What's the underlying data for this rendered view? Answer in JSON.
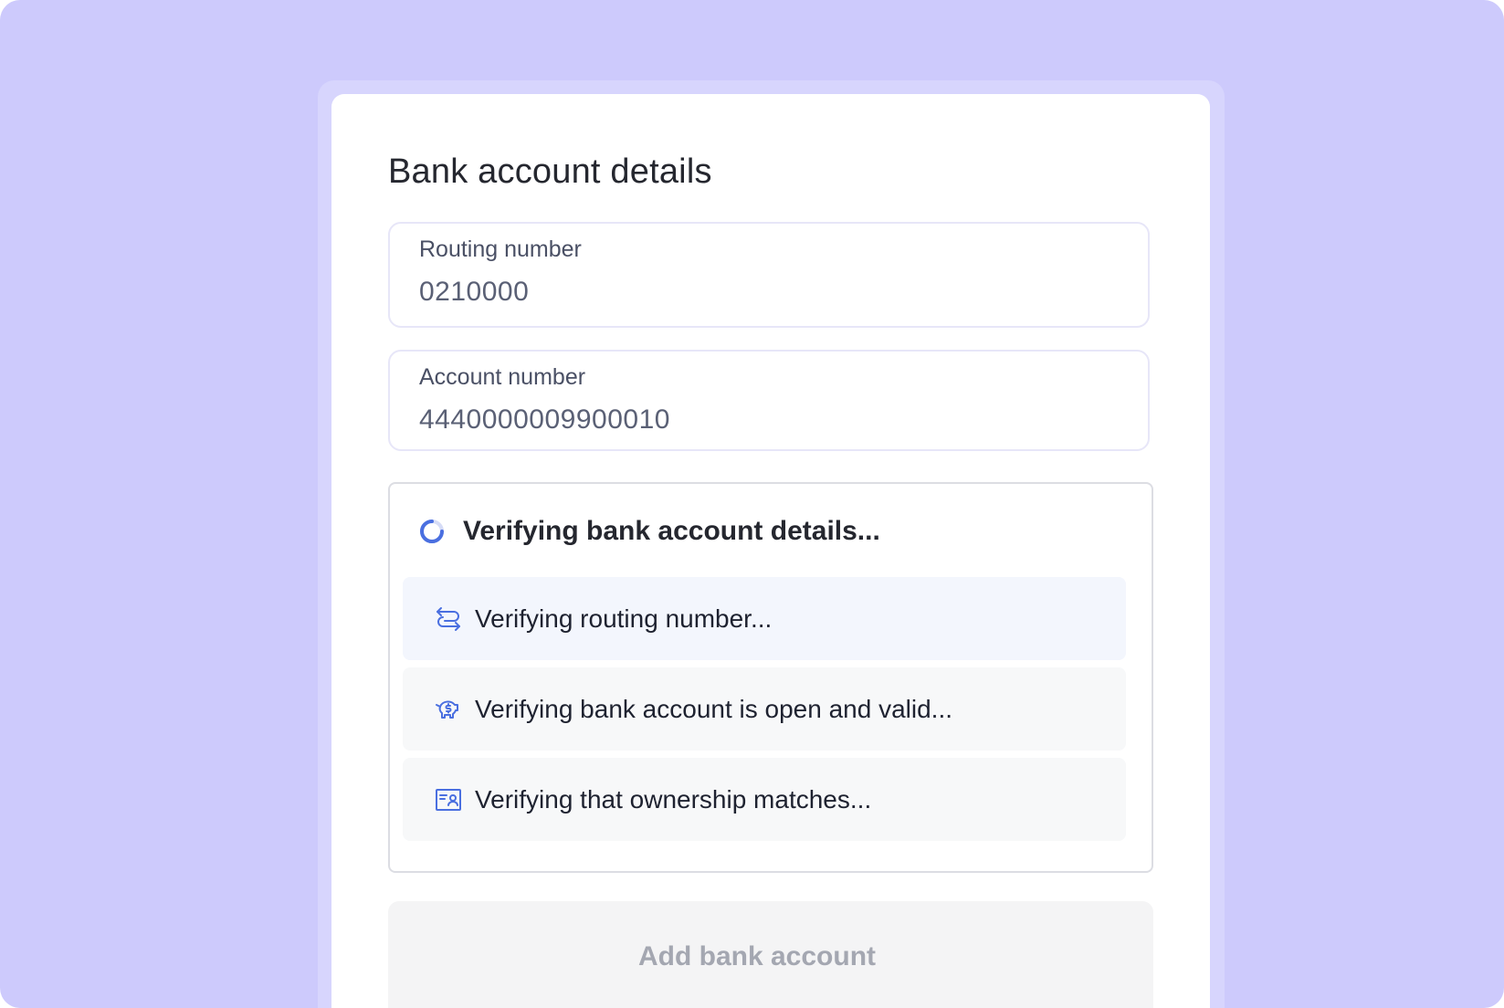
{
  "form": {
    "title": "Bank account details",
    "routing": {
      "label": "Routing number",
      "value": "0210000"
    },
    "account": {
      "label": "Account number",
      "value": "4440000009900010"
    }
  },
  "verification": {
    "title": "Verifying bank account details...",
    "spinner_icon": "loading-spinner-icon",
    "steps": [
      {
        "icon": "arrows-exchange-icon",
        "label": "Verifying routing number...",
        "state": "active"
      },
      {
        "icon": "piggy-bank-dollar-icon",
        "label": "Verifying bank account is open and valid...",
        "state": "pending"
      },
      {
        "icon": "id-card-person-icon",
        "label": "Verifying that ownership matches...",
        "state": "pending"
      }
    ]
  },
  "submit": {
    "label": "Add bank account",
    "disabled": true
  },
  "colors": {
    "backdrop": "#cdcafc",
    "accent": "#4a6fe0",
    "active_step": "#f3f6fd",
    "pending_step": "#f7f8f9",
    "disabled_text": "#a4a7b1"
  }
}
